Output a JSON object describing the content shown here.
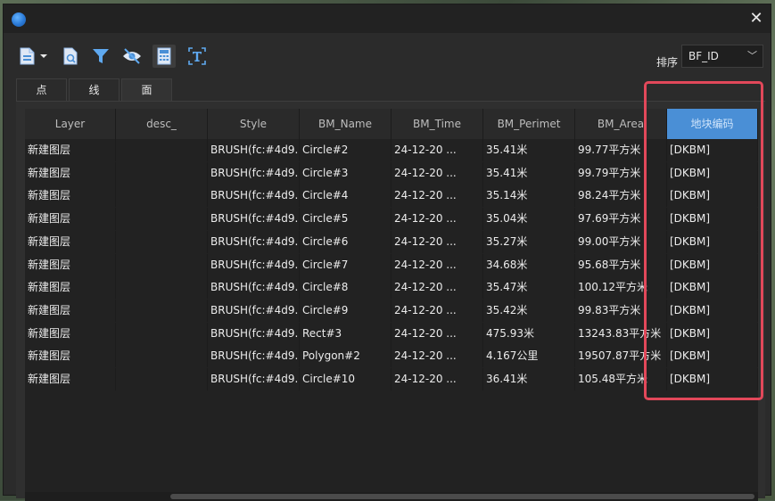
{
  "window": {
    "title": ""
  },
  "toolbar": {
    "tools": [
      {
        "icon": "document-dropdown-icon"
      },
      {
        "icon": "document-search-icon"
      },
      {
        "icon": "filter-icon"
      },
      {
        "icon": "visibility-off-icon"
      },
      {
        "icon": "calculator-icon"
      },
      {
        "icon": "text-field-icon"
      }
    ],
    "sort_label": "排序",
    "sort_value": "BF_ID"
  },
  "tabs": [
    {
      "label": "点",
      "active": false
    },
    {
      "label": "线",
      "active": false
    },
    {
      "label": "面",
      "active": true
    }
  ],
  "table": {
    "columns": [
      "Layer",
      "desc_",
      "Style",
      "BM_Name",
      "BM_Time",
      "BM_Perimet",
      "BM_Area",
      "地块编码"
    ],
    "selected_column": 7,
    "rows": [
      [
        "新建图层",
        "",
        "BRUSH(fc:#4d9...",
        "Circle#2",
        "24-12-20 ...",
        "35.41米",
        "99.77平方米",
        "[DKBM]"
      ],
      [
        "新建图层",
        "",
        "BRUSH(fc:#4d9...",
        "Circle#3",
        "24-12-20 ...",
        "35.41米",
        "99.79平方米",
        "[DKBM]"
      ],
      [
        "新建图层",
        "",
        "BRUSH(fc:#4d9...",
        "Circle#4",
        "24-12-20 ...",
        "35.14米",
        "98.24平方米",
        "[DKBM]"
      ],
      [
        "新建图层",
        "",
        "BRUSH(fc:#4d9...",
        "Circle#5",
        "24-12-20 ...",
        "35.04米",
        "97.69平方米",
        "[DKBM]"
      ],
      [
        "新建图层",
        "",
        "BRUSH(fc:#4d9...",
        "Circle#6",
        "24-12-20 ...",
        "35.27米",
        "99.00平方米",
        "[DKBM]"
      ],
      [
        "新建图层",
        "",
        "BRUSH(fc:#4d9...",
        "Circle#7",
        "24-12-20 ...",
        "34.68米",
        "95.68平方米",
        "[DKBM]"
      ],
      [
        "新建图层",
        "",
        "BRUSH(fc:#4d9...",
        "Circle#8",
        "24-12-20 ...",
        "35.47米",
        "100.12平方米",
        "[DKBM]"
      ],
      [
        "新建图层",
        "",
        "BRUSH(fc:#4d9...",
        "Circle#9",
        "24-12-20 ...",
        "35.42米",
        "99.83平方米",
        "[DKBM]"
      ],
      [
        "新建图层",
        "",
        "BRUSH(fc:#4d9...",
        "Rect#3",
        "24-12-20 ...",
        "475.93米",
        "13243.83平方米",
        "[DKBM]"
      ],
      [
        "新建图层",
        "",
        "BRUSH(fc:#4d9...",
        "Polygon#2",
        "24-12-20 ...",
        "4.167公里",
        "19507.87平方米",
        "[DKBM]"
      ],
      [
        "新建图层",
        "",
        "BRUSH(fc:#4d9...",
        "Circle#10",
        "24-12-20 ...",
        "36.41米",
        "105.48平方米",
        "[DKBM]"
      ]
    ]
  },
  "colors": {
    "accent": "#4a8fd6",
    "highlight_border": "#e2485a",
    "window_bg": "#2b2b2b"
  }
}
